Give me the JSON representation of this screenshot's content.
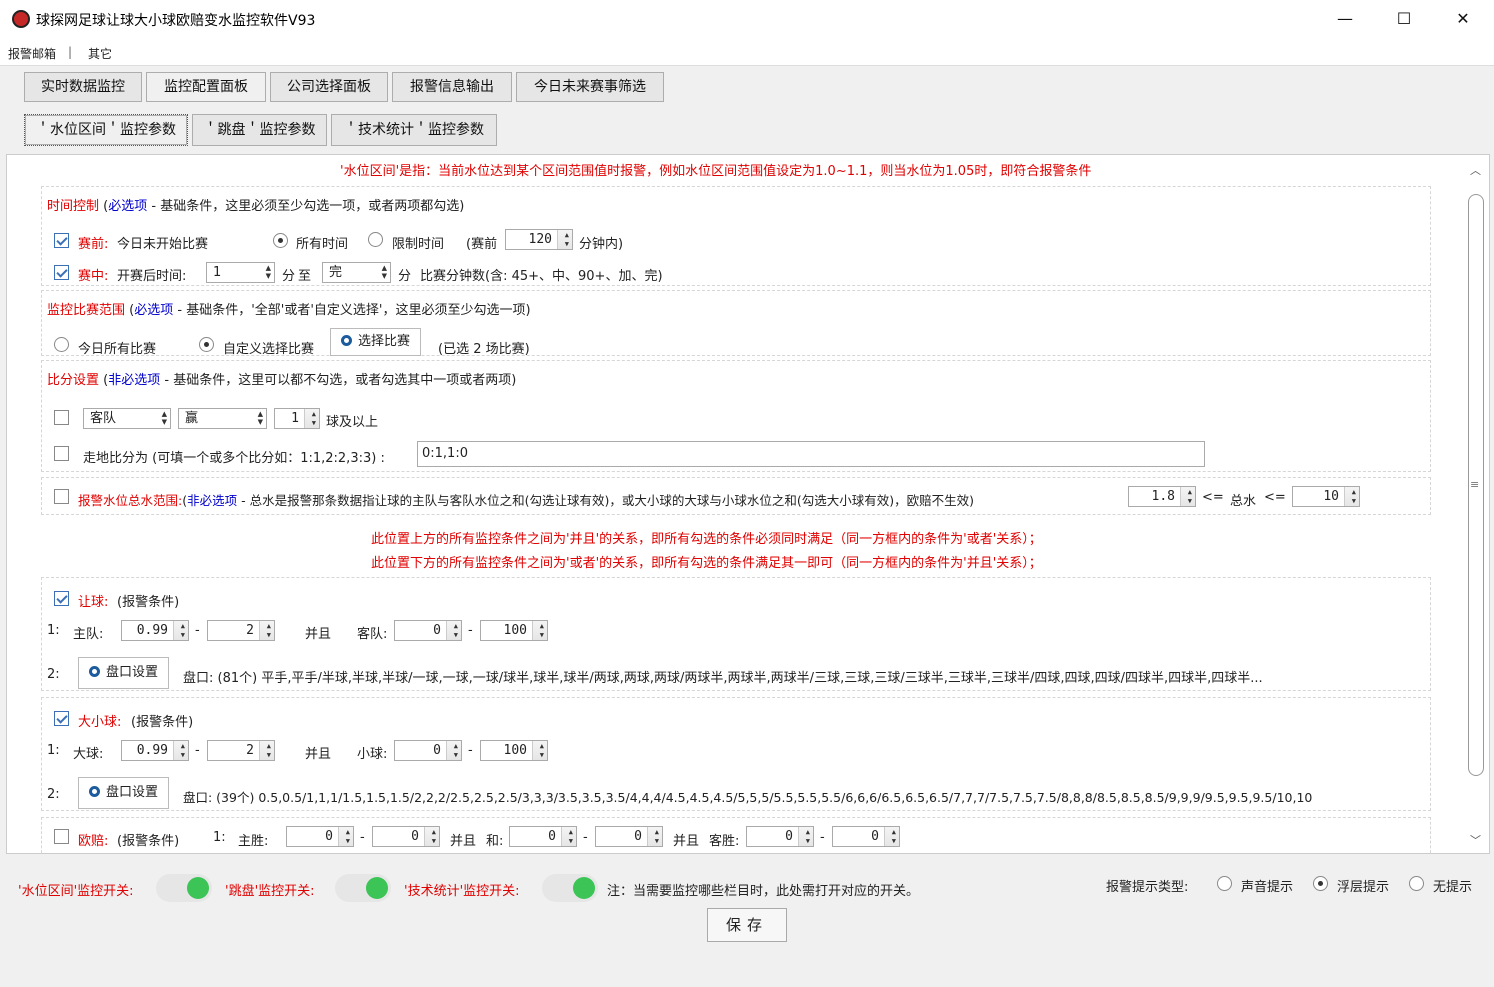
{
  "window": {
    "title": "球探网足球让球大小球欧赔变水监控软件V93",
    "minimize": "—",
    "maximize": "☐",
    "close": "✕"
  },
  "menu": {
    "item1": "报警邮箱",
    "sep": "|",
    "item2": "其它"
  },
  "tabs": [
    "实时数据监控",
    "监控配置面板",
    "公司选择面板",
    "报警信息输出",
    "今日未来赛事筛选"
  ],
  "subtabs": [
    "＇水位区间＇监控参数",
    "＇跳盘＇监控参数",
    "＇技术统计＇监控参数"
  ],
  "notice": "'水位区间'是指：当前水位达到某个区间范围值时报警，例如水位区间范围值设定为1.0~1.1，则当水位为1.05时，即符合报警条件",
  "time_control": {
    "title": "时间控制",
    "paren_open": "(",
    "req": "必选项",
    "desc": " - 基础条件，这里必须至少勾选一项，或者两项都勾选)",
    "pre_label": "赛前:",
    "pre_text": "今日未开始比赛",
    "all_time": "所有时间",
    "limit_time": "限制时间",
    "before_label": "(赛前",
    "before_value": "120",
    "minutes_inside": "分钟内)",
    "in_label": "赛中:",
    "in_text": "开赛后时间:",
    "from_value": "1",
    "fen1": "分",
    "to": "至",
    "to_value": "完",
    "fen2": "分",
    "match_minutes": "比赛分钟数(含: 45+、中、90+、加、完)"
  },
  "range": {
    "title": "监控比赛范围",
    "paren_open": "(",
    "req": "必选项",
    "desc": " - 基础条件，'全部'或者'自定义选择'，这里必须至少勾选一项)",
    "all_matches": "今日所有比赛",
    "custom": "自定义选择比赛",
    "select_button": "选择比赛",
    "selected": "(已选 2 场比赛)"
  },
  "score": {
    "title": "比分设置",
    "paren_open": "(",
    "opt": "非必选项",
    "desc": " - 基础条件，这里可以都不勾选，或者勾选其中一项或者两项)",
    "team": "客队",
    "result": "赢",
    "goals": "1",
    "goals_suffix": "球及以上",
    "score_label": "走地比分为 (可填一个或多个比分如：1:1,2:2,3:3)  :",
    "score_value": "0:1,1:0"
  },
  "total": {
    "title": "报警水位总水范围:",
    "paren_open": "(",
    "opt": "非必选项",
    "desc": " - 总水是报警那条数据指让球的主队与客队水位之和(勾选让球有效)，或大小球的大球与小球水位之和(勾选大小球有效)，欧赔不生效)",
    "min": "1.8",
    "le1": "<=",
    "label": "总水",
    "le2": "<=",
    "max": "10"
  },
  "relation": {
    "line1": "此位置上方的所有监控条件之间为'并且'的关系，即所有勾选的条件必须同时满足（同一方框内的条件为'或者'关系）；",
    "line2": "此位置下方的所有监控条件之间为'或者'的关系，即所有勾选的条件满足其一即可（同一方框内的条件为'并且'关系）；"
  },
  "handicap": {
    "title": "让球:",
    "cond": "(报警条件)",
    "row1": "1:",
    "home": "主队:",
    "home_min": "0.99",
    "dash1": "-",
    "home_max": "2",
    "and": "并且",
    "away": "客队:",
    "away_min": "0",
    "dash2": "-",
    "away_max": "100",
    "row2": "2:",
    "btn": "盘口设置",
    "lines": "盘口: (81个) 平手,平手/半球,半球,半球/一球,一球,一球/球半,球半,球半/两球,两球,两球/两球半,两球半,两球半/三球,三球,三球/三球半,三球半,三球半/四球,四球,四球/四球半,四球半,四球半..."
  },
  "overunder": {
    "title": "大小球:",
    "cond": "(报警条件)",
    "row1": "1:",
    "over": "大球:",
    "over_min": "0.99",
    "dash1": "-",
    "over_max": "2",
    "and": "并且",
    "under": "小球:",
    "under_min": "0",
    "dash2": "-",
    "under_max": "100",
    "row2": "2:",
    "btn": "盘口设置",
    "lines": "盘口: (39个) 0.5,0.5/1,1,1/1.5,1.5,1.5/2,2,2/2.5,2.5,2.5/3,3,3/3.5,3.5,3.5/4,4,4/4.5,4.5,4.5/5,5,5/5.5,5.5,5.5/6,6,6/6.5,6.5,6.5/7,7,7/7.5,7.5,7.5/8,8,8/8.5,8.5,8.5/9,9,9/9.5,9.5,9.5/10,10"
  },
  "euro": {
    "title": "欧赔:",
    "cond": "(报警条件)",
    "row1": "1:",
    "home": "主胜:",
    "home_min": "0",
    "dash1": "-",
    "home_max": "0",
    "and1": "并且",
    "draw": "和:",
    "draw_min": "0",
    "dash2": "-",
    "draw_max": "0",
    "and2": "并且",
    "away": "客胜:",
    "away_min": "0",
    "dash3": "-",
    "away_max": "0"
  },
  "footer": {
    "switch1": "'水位区间'监控开关:",
    "switch2": "'跳盘'监控开关:",
    "switch3": "'技术统计'监控开关:",
    "note": "注：当需要监控哪些栏目时，此处需打开对应的开关。",
    "alert_type": "报警提示类型:",
    "sound": "声音提示",
    "float": "浮层提示",
    "none": "无提示",
    "save": "保存"
  },
  "colors": {
    "red": "#e00000",
    "blue": "#0000cc",
    "toggle_on": "#3cc456"
  }
}
